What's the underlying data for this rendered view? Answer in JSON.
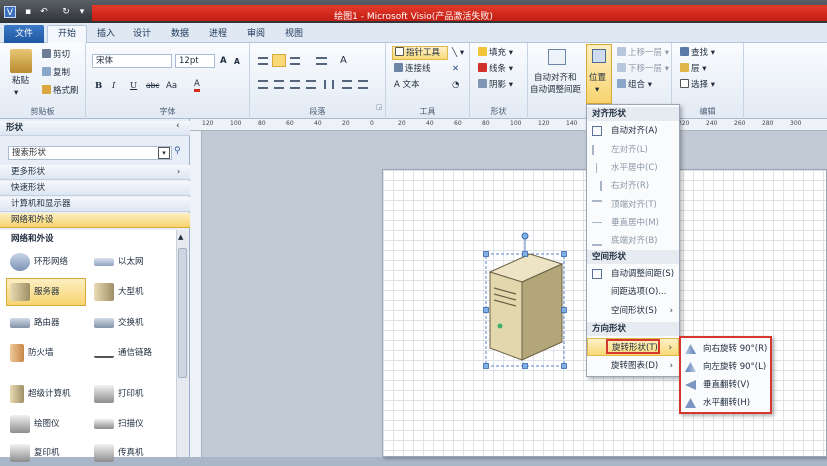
{
  "window": {
    "title": "绘图1 - Microsoft Visio(产品激活失败)"
  },
  "quick_access": {
    "logo": "V",
    "save": "▪",
    "undo": "↶",
    "redo": "↻",
    "customize": "▾"
  },
  "tabs": [
    "文件",
    "开始",
    "插入",
    "设计",
    "数据",
    "进程",
    "审阅",
    "视图"
  ],
  "ribbon": {
    "clipboard": {
      "paste": "粘贴",
      "cut": "剪切",
      "copy": "复制",
      "format_painter": "格式刷",
      "group": "剪贴板"
    },
    "font": {
      "name": "宋体",
      "size": "12pt",
      "grow": "A",
      "shrink": "A",
      "bold": "B",
      "italic": "I",
      "underline": "U",
      "strike": "abc",
      "case": "Aa",
      "color": "A",
      "group": "字体"
    },
    "paragraph": {
      "group": "段落"
    },
    "tools": {
      "pointer": "指针工具",
      "connector": "连接线",
      "text": "A 文本",
      "group": "工具"
    },
    "shape": {
      "fill": "填充",
      "line": "线条",
      "shadow": "阴影",
      "group": "形状"
    },
    "arrange": {
      "auto_align": "自动对齐和",
      "auto_space": "自动调整间距",
      "position": "位置",
      "bring_forward": "上移一层",
      "send_backward": "下移一层",
      "group_btn": "组合",
      "group": "排列"
    },
    "editing": {
      "find": "查找",
      "layers": "层",
      "select": "选择",
      "group": "编辑"
    }
  },
  "shapes_panel": {
    "title": "形状",
    "search_placeholder": "搜索形状",
    "more_shapes": "更多形状",
    "quick_shapes": "快速形状",
    "computers": "计算机和显示器",
    "network_peripherals": "网络和外设",
    "stencil_title": "网络和外设",
    "stencils": [
      {
        "label": "环形网络",
        "icon": "ring-network-icon"
      },
      {
        "label": "以太网",
        "icon": "ethernet-icon"
      },
      {
        "label": "服务器",
        "icon": "server-icon"
      },
      {
        "label": "大型机",
        "icon": "mainframe-icon"
      },
      {
        "label": "路由器",
        "icon": "router-icon"
      },
      {
        "label": "交换机",
        "icon": "switch-icon"
      },
      {
        "label": "防火墙",
        "icon": "firewall-icon"
      },
      {
        "label": "通信链路",
        "icon": "comm-link-icon"
      },
      {
        "label": "超级计算机",
        "icon": "supercomputer-icon"
      },
      {
        "label": "打印机",
        "icon": "printer-icon"
      },
      {
        "label": "绘图仪",
        "icon": "plotter-icon"
      },
      {
        "label": "扫描仪",
        "icon": "scanner-icon"
      },
      {
        "label": "复印机",
        "icon": "copier-icon"
      },
      {
        "label": "传真机",
        "icon": "fax-icon"
      }
    ]
  },
  "ruler": {
    "ticks": [
      "120",
      "100",
      "80",
      "60",
      "40",
      "20",
      "0",
      "20",
      "40",
      "60",
      "80",
      "100",
      "120",
      "140",
      "160",
      "180",
      "200",
      "220",
      "240",
      "260",
      "280",
      "300"
    ]
  },
  "position_menu": {
    "header_align": "对齐形状",
    "auto_align": "自动对齐(A)",
    "align_left": "左对齐(L)",
    "align_center": "水平居中(C)",
    "align_right": "右对齐(R)",
    "align_top": "顶端对齐(T)",
    "align_middle": "垂直居中(M)",
    "align_bottom": "底端对齐(B)",
    "header_space": "空间形状",
    "auto_space": "自动调整间距(S)",
    "spacing_options": "间距选项(O)...",
    "space_shapes": "空间形状(S)",
    "header_orient": "方向形状",
    "rotate_shapes": "旋转形状(T)",
    "rotate_diagram": "旋转图表(D)"
  },
  "rotate_submenu": {
    "rotate_right": "向右旋转 90°(R)",
    "rotate_left": "向左旋转 90°(L)",
    "flip_vertical": "垂直翻转(V)",
    "flip_horizontal": "水平翻转(H)"
  }
}
